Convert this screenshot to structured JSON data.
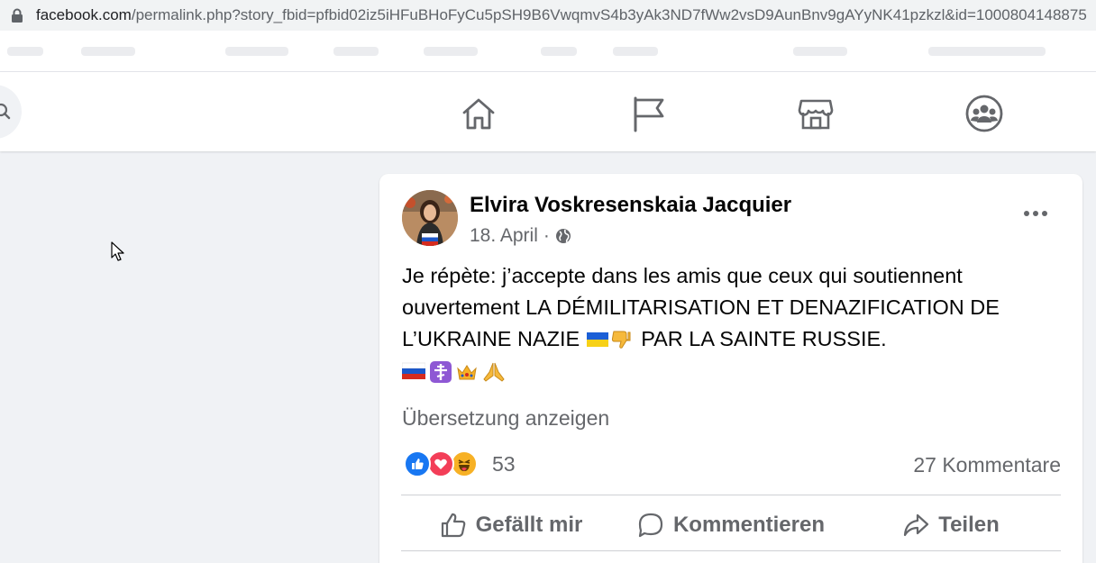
{
  "browser": {
    "url_domain": "facebook.com",
    "url_path": "/permalink.php?story_fbid=pfbid02iz5iHFuBHoFyCu5pSH9B6VwqmvS4b3yAk3ND7fWw2vsD9AunBnv9gAYyNK41pzkzl&id=1000804148875"
  },
  "topnav": {
    "icons": [
      "home-icon",
      "pages-flag-icon",
      "marketplace-icon",
      "groups-icon"
    ]
  },
  "post": {
    "author": "Elvira Voskresenskaia Jacquier",
    "date": "18. April",
    "separator": "·",
    "privacy_icon": "globe-icon",
    "body_line1": "Je répète: j’accepte dans les amis que ceux qui soutiennent",
    "body_line2": "ouvertement LA DÉMILITARISATION ET DENAZIFICATION DE",
    "body_line3_pre": "L’UKRAINE NAZIE",
    "body_line3_post": "PAR LA SAINTE RUSSIE.",
    "inline_emojis": [
      "ukraine-flag",
      "thumbs-down"
    ],
    "emoji_row": [
      "russia-flag",
      "orthodox-cross",
      "crown",
      "praying-hands"
    ],
    "translate_label": "Übersetzung anzeigen",
    "reactions": [
      "like",
      "love",
      "haha"
    ],
    "reaction_count": "53",
    "comments_count": "27 Kommentare",
    "actions": {
      "like": "Gefällt mir",
      "comment": "Kommentieren",
      "share": "Teilen"
    }
  },
  "colors": {
    "fb_blue": "#1877f2",
    "love_red": "#f33e58",
    "haha_yellow": "#f7b125",
    "secondary_text": "#65676b",
    "background": "#f0f2f5"
  }
}
